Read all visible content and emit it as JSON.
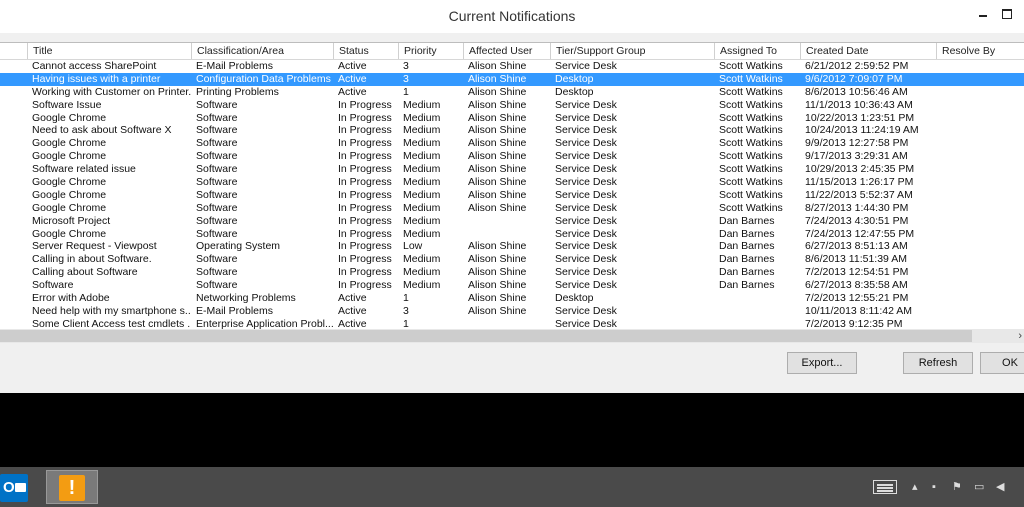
{
  "window": {
    "title": "Current Notifications"
  },
  "columns": [
    "",
    "Title",
    "Classification/Area",
    "Status",
    "Priority",
    "Affected User",
    "Tier/Support Group",
    "Assigned To",
    "Created Date",
    "Resolve By"
  ],
  "rows": [
    [
      "",
      "Cannot access SharePoint",
      "E-Mail Problems",
      "Active",
      "3",
      "Alison Shine",
      "Service Desk",
      "Scott Watkins",
      "6/21/2012 2:59:52 PM",
      ""
    ],
    [
      "",
      "Having issues with a printer",
      "Configuration Data Problems",
      "Active",
      "3",
      "Alison Shine",
      "Desktop",
      "Scott Watkins",
      "9/6/2012 7:09:07 PM",
      ""
    ],
    [
      "",
      "Working with Customer on Printer...",
      "Printing Problems",
      "Active",
      "1",
      "Alison Shine",
      "Desktop",
      "Scott Watkins",
      "8/6/2013 10:56:46 AM",
      ""
    ],
    [
      "",
      "Software Issue",
      "Software",
      "In Progress",
      "Medium",
      "Alison Shine",
      "Service Desk",
      "Scott Watkins",
      "11/1/2013 10:36:43 AM",
      ""
    ],
    [
      "",
      "Google Chrome",
      "Software",
      "In Progress",
      "Medium",
      "Alison Shine",
      "Service Desk",
      "Scott Watkins",
      "10/22/2013 1:23:51 PM",
      ""
    ],
    [
      "",
      "Need to ask about Software X",
      "Software",
      "In Progress",
      "Medium",
      "Alison Shine",
      "Service Desk",
      "Scott Watkins",
      "10/24/2013 11:24:19 AM",
      ""
    ],
    [
      "",
      "Google Chrome",
      "Software",
      "In Progress",
      "Medium",
      "Alison Shine",
      "Service Desk",
      "Scott Watkins",
      "9/9/2013 12:27:58 PM",
      ""
    ],
    [
      "",
      "Google Chrome",
      "Software",
      "In Progress",
      "Medium",
      "Alison Shine",
      "Service Desk",
      "Scott Watkins",
      "9/17/2013 3:29:31 AM",
      ""
    ],
    [
      "",
      "Software related issue",
      "Software",
      "In Progress",
      "Medium",
      "Alison Shine",
      "Service Desk",
      "Scott Watkins",
      "10/29/2013 2:45:35 PM",
      ""
    ],
    [
      "",
      "Google Chrome",
      "Software",
      "In Progress",
      "Medium",
      "Alison Shine",
      "Service Desk",
      "Scott Watkins",
      "11/15/2013 1:26:17 PM",
      ""
    ],
    [
      "",
      "Google Chrome",
      "Software",
      "In Progress",
      "Medium",
      "Alison Shine",
      "Service Desk",
      "Scott Watkins",
      "11/22/2013 5:52:37 AM",
      ""
    ],
    [
      "",
      "Google Chrome",
      "Software",
      "In Progress",
      "Medium",
      "Alison Shine",
      "Service Desk",
      "Scott Watkins",
      "8/27/2013 1:44:30 PM",
      ""
    ],
    [
      "",
      "Microsoft Project",
      "Software",
      "In Progress",
      "Medium",
      "",
      "Service Desk",
      "Dan Barnes",
      "7/24/2013 4:30:51 PM",
      ""
    ],
    [
      "",
      "Google Chrome",
      "Software",
      "In Progress",
      "Medium",
      "",
      "Service Desk",
      "Dan Barnes",
      "7/24/2013 12:47:55 PM",
      ""
    ],
    [
      "",
      "Server Request - Viewpost",
      "Operating System",
      "In Progress",
      "Low",
      "Alison Shine",
      "Service Desk",
      "Dan Barnes",
      "6/27/2013 8:51:13 AM",
      ""
    ],
    [
      "",
      "Calling in about Software.",
      "Software",
      "In Progress",
      "Medium",
      "Alison Shine",
      "Service Desk",
      "Dan Barnes",
      "8/6/2013 11:51:39 AM",
      ""
    ],
    [
      "",
      "Calling about Software",
      "Software",
      "In Progress",
      "Medium",
      "Alison Shine",
      "Service Desk",
      "Dan Barnes",
      "7/2/2013 12:54:51 PM",
      ""
    ],
    [
      "",
      "Software",
      "Software",
      "In Progress",
      "Medium",
      "Alison Shine",
      "Service Desk",
      "Dan Barnes",
      "6/27/2013 8:35:58 AM",
      ""
    ],
    [
      "",
      "Error with Adobe",
      "Networking Problems",
      "Active",
      "1",
      "Alison Shine",
      "Desktop",
      "",
      "7/2/2013 12:55:21 PM",
      ""
    ],
    [
      "",
      "Need help with my smartphone s...",
      "E-Mail Problems",
      "Active",
      "3",
      "Alison Shine",
      "Service Desk",
      "",
      "10/11/2013 8:11:42 AM",
      ""
    ],
    [
      "",
      "Some Client Access test cmdlets ...",
      "Enterprise Application Probl...",
      "Active",
      "1",
      "",
      "Service Desk",
      "",
      "7/2/2013 9:12:35 PM",
      ""
    ]
  ],
  "selected_row_index": 1,
  "buttons": {
    "export": "Export...",
    "refresh": "Refresh",
    "ok": "OK"
  },
  "taskbar": {
    "outlook_letter": "O",
    "alert_glyph": "!"
  },
  "icons": {
    "minimize": "minimize-icon",
    "maximize": "maximize-icon",
    "close": "close-icon",
    "scroll_right": "chevron-right-icon",
    "keyboard": "keyboard-icon",
    "tray_up": "chevron-up-icon",
    "network": "network-icon",
    "flag": "flag-icon",
    "monitor": "monitor-icon",
    "speaker": "speaker-icon"
  },
  "colors": {
    "selection": "#3399ff",
    "alert": "#f39c12",
    "outlook": "#0072c6"
  }
}
